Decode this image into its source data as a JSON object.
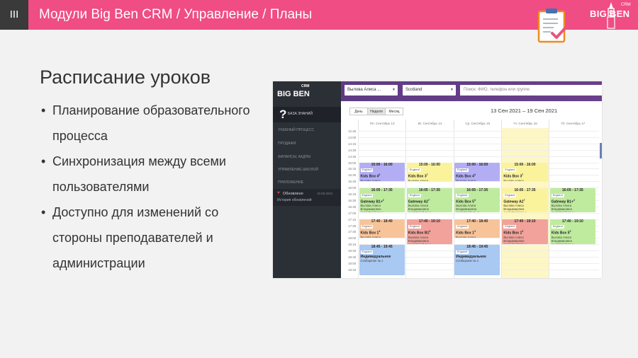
{
  "header": {
    "section_number": "III",
    "title": "Модули Big Ben CRM / Управление / Планы",
    "logo_text": "BIG BEN",
    "logo_crm": "CRM"
  },
  "colors": {
    "header_pink": "#ef4d83",
    "section_dark": "#3a3a3a",
    "sidebar_dark": "#2b2f36",
    "topbar_purple": "#5f3b86",
    "event_purple": "#b3aef4",
    "event_yellow": "#fbf39c",
    "event_green": "#bfeb9e",
    "event_orange": "#f7c49a",
    "event_red": "#f2a29b",
    "event_blue": "#a9c8f2",
    "today_highlight": "#fdf7c6"
  },
  "slide": {
    "title": "Расписание уроков",
    "bullets": [
      "Планирование образовательного процесса",
      "Синхронизация между всеми пользователями",
      "Доступно для изменений со стороны преподавателей и администрации"
    ]
  },
  "app": {
    "logo": "BIG BEN",
    "logo_crm": "CRM",
    "sidebar": {
      "help_label": "БАЗА ЗНАНИЙ",
      "items": [
        "УЧЕБНЫЙ ПРОЦЕСС",
        "ПРОДАЖИ",
        "ФИНАНСЫ, КАДРЫ",
        "УПРАВЛЕНИЕ ШКОЛОЙ",
        "ПРИЛОЖЕНИЕ"
      ],
      "updated_label": "Обновлено",
      "updated_date": "10.05.2021",
      "history_label": "История обновлений"
    },
    "topbar": {
      "teacher_select": "Вылова Алиса ...",
      "school_select": "Scotland",
      "search_placeholder": "Поиск: ФИО, телефон или группе"
    },
    "views": [
      "День",
      "Неделя",
      "Месяц"
    ],
    "active_view": "Неделя",
    "date_range": "13 Сен 2021 – 19 Сен 2021",
    "days": [
      "Пн. Сентябрь 13",
      "Вт. Сентябрь 14",
      "Ср. Сентябрь 15",
      "Чт. Сентябрь 16",
      "Пт. Сентябрь 17"
    ],
    "times": [
      "12:45",
      "14:00",
      "14:15",
      "14:30",
      "14:45",
      "15:00",
      "15:15",
      "15:30",
      "15:45",
      "16:00",
      "16:15",
      "16:30",
      "16:45",
      "17:00",
      "17:15",
      "17:30",
      "17:45",
      "18:00",
      "18:15",
      "18:30",
      "18:45",
      "19:00",
      "19:15"
    ],
    "events": [
      {
        "day": 0,
        "row": 5,
        "span": 3,
        "color": "event_purple",
        "time": "15:00 - 16:00",
        "tag": "England",
        "title": "Kids Box 4",
        "sup": "3",
        "teacher": "Вылова Алиса",
        "extra": "Владимировна",
        "lang": ""
      },
      {
        "day": 1,
        "row": 5,
        "span": 3,
        "color": "event_yellow",
        "time": "15:00 - 16:00",
        "tag": "England",
        "title": "Kids Box 3",
        "sup": "7",
        "teacher": "Вылова Алиса",
        "extra": "Владимировна",
        "lang": ""
      },
      {
        "day": 2,
        "row": 5,
        "span": 3,
        "color": "event_purple",
        "time": "15:00 - 16:00",
        "tag": "England",
        "title": "Kids Box 4",
        "sup": "3",
        "teacher": "Вылова Алиса",
        "extra": "Владимировна",
        "lang": ""
      },
      {
        "day": 3,
        "row": 5,
        "span": 3,
        "color": "event_yellow",
        "time": "15:00 - 16:00",
        "tag": "England",
        "title": "Kids Box 3",
        "sup": "7",
        "teacher": "Вылова Алиса",
        "extra": "Владимировна",
        "lang": ""
      },
      {
        "day": 0,
        "row": 9,
        "span": 4,
        "color": "event_green",
        "time": "16:05 - 17:35",
        "tag": "England",
        "title": "Gateway B1+",
        "sup": "2",
        "teacher": "Вылова Алиса",
        "extra": "Владимировна",
        "lang": "Английский язык"
      },
      {
        "day": 1,
        "row": 9,
        "span": 4,
        "color": "event_green",
        "time": "16:05 - 17:35",
        "tag": "England",
        "title": "Gateway A2",
        "sup": "7",
        "teacher": "Вылова Алиса",
        "extra": "Владимировна",
        "lang": "Английский язык"
      },
      {
        "day": 2,
        "row": 9,
        "span": 4,
        "color": "event_green",
        "time": "16:05 - 17:35",
        "tag": "England",
        "title": "Kids Box 5",
        "sup": "3",
        "teacher": "Вылова Алиса",
        "extra": "Владимировна",
        "lang": "Английский язык"
      },
      {
        "day": 3,
        "row": 9,
        "span": 4,
        "color": "event_yellow",
        "time": "16:05 - 17:35",
        "tag": "England",
        "title": "Gateway A2",
        "sup": "7",
        "teacher": "Вылова Алиса",
        "extra": "Владимировна",
        "lang": "Английский язык"
      },
      {
        "day": 4,
        "row": 9,
        "span": 4,
        "color": "event_green",
        "time": "16:05 - 17:35",
        "tag": "England",
        "title": "Gateway B1+",
        "sup": "2",
        "teacher": "Вылова Алиса",
        "extra": "Владимировна",
        "lang": "Английский язык"
      },
      {
        "day": 0,
        "row": 14,
        "span": 3,
        "color": "event_orange",
        "time": "17:40 - 18:40",
        "tag": "England",
        "title": "Kids Box 1",
        "sup": "3",
        "teacher": "Вылова Алиса",
        "extra": "Владимировна",
        "lang": ""
      },
      {
        "day": 1,
        "row": 14,
        "span": 4,
        "color": "event_red",
        "time": "17:40 - 19:10",
        "tag": "England",
        "title": "Kids Box B1",
        "sup": "3",
        "teacher": "Вылова Алиса",
        "extra": "Владимировна",
        "lang": "Английский язык"
      },
      {
        "day": 2,
        "row": 14,
        "span": 3,
        "color": "event_orange",
        "time": "17:40 - 18:40",
        "tag": "England",
        "title": "Kids Box 1",
        "sup": "3",
        "teacher": "Вылова Алиса",
        "extra": "Владимировна",
        "lang": ""
      },
      {
        "day": 3,
        "row": 14,
        "span": 4,
        "color": "event_red",
        "time": "17:40 - 19:10",
        "tag": "England",
        "title": "Kids Box 1",
        "sup": "3",
        "teacher": "Вылова Алиса",
        "extra": "Владимировна",
        "lang": "Английский язык"
      },
      {
        "day": 4,
        "row": 14,
        "span": 4,
        "color": "event_green",
        "time": "17:40 - 19:10",
        "tag": "England",
        "title": "Kids Box 5",
        "sup": "3",
        "teacher": "Вылова Алиса",
        "extra": "Владимировна",
        "lang": "Английский язык"
      },
      {
        "day": 0,
        "row": 18,
        "span": 5,
        "color": "event_blue",
        "time": "18:45 - 19:45",
        "tag": "England",
        "title": "Индивидуальное",
        "sup": "",
        "teacher": "Сообщение № 1",
        "extra": "",
        "lang": ""
      },
      {
        "day": 2,
        "row": 18,
        "span": 5,
        "color": "event_blue",
        "time": "18:45 - 19:45",
        "tag": "England",
        "title": "Индивидуальное",
        "sup": "",
        "teacher": "Сообщение № 1",
        "extra": "",
        "lang": ""
      }
    ]
  }
}
